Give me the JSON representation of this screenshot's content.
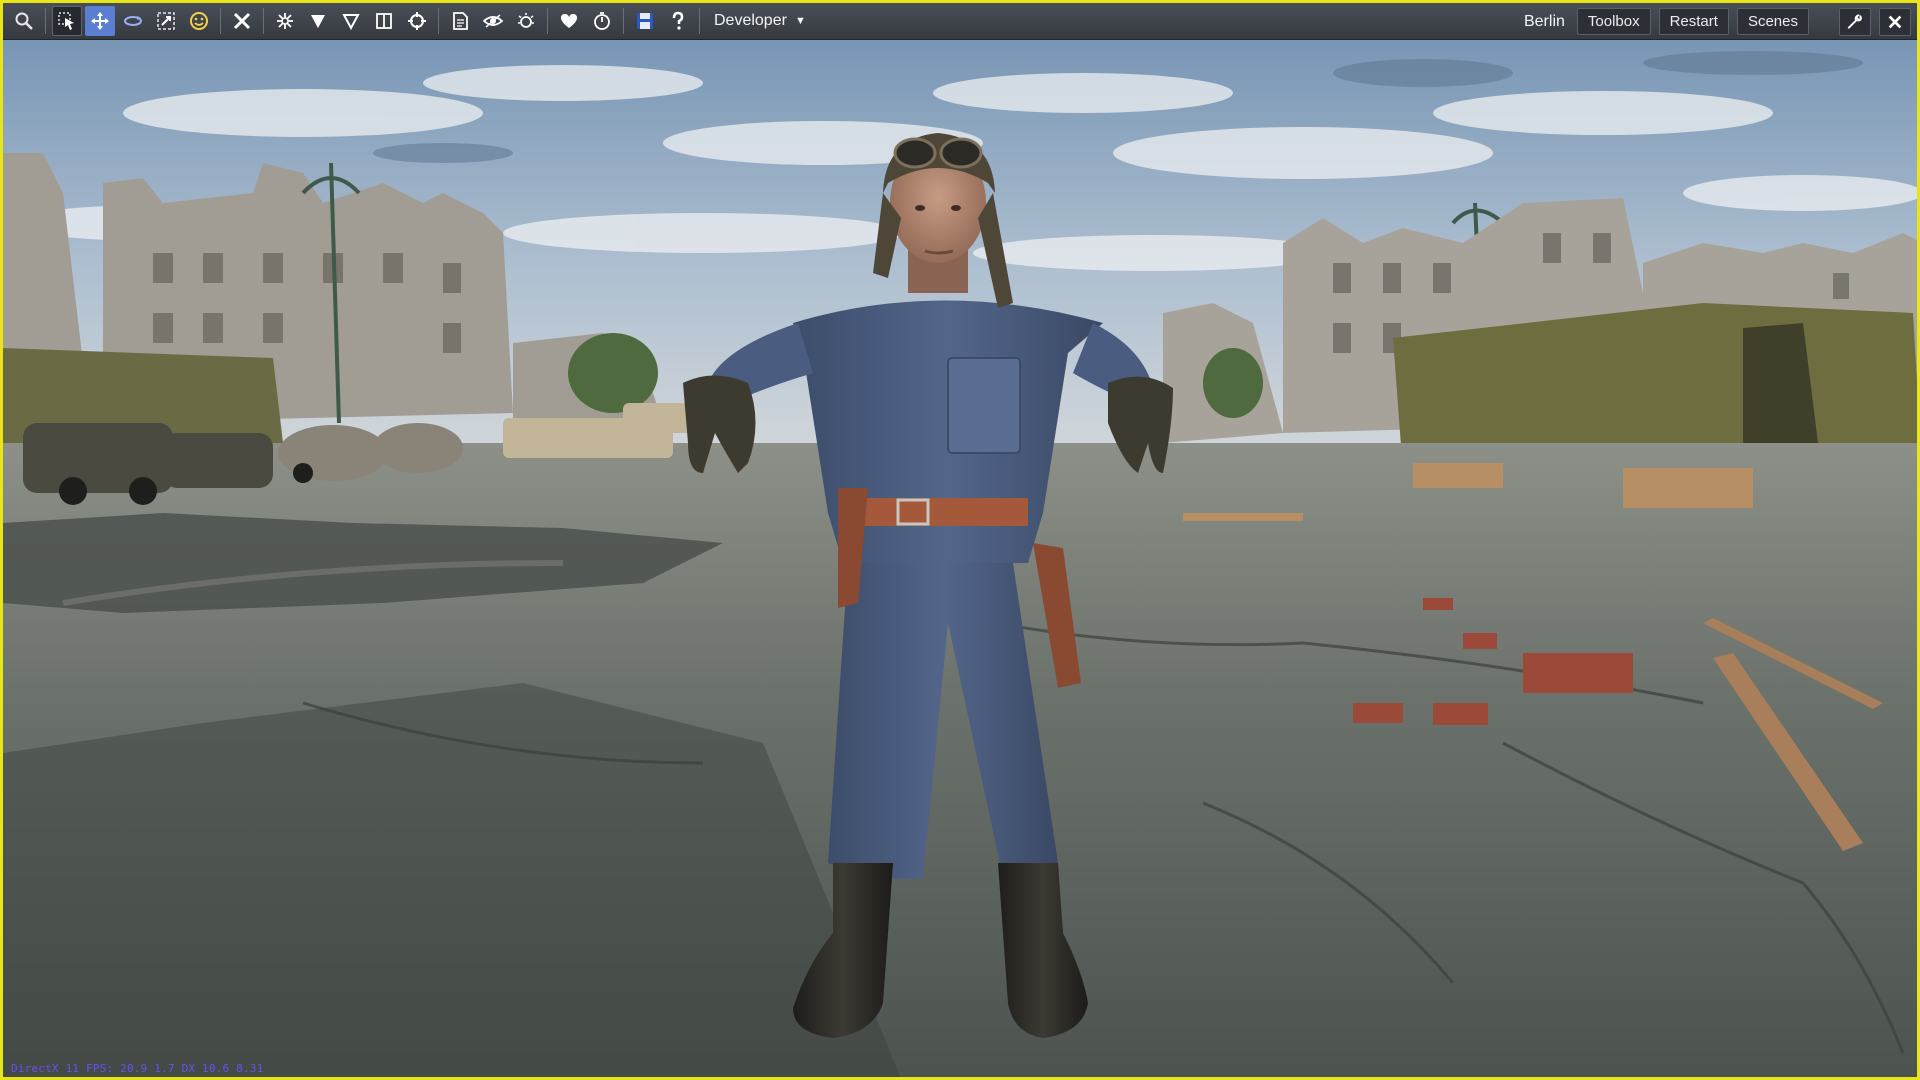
{
  "toolbar": {
    "mode_dropdown": {
      "selected": "Developer"
    },
    "tools": [
      {
        "icon": "search-icon"
      },
      {
        "icon": "select-cursor-icon"
      },
      {
        "icon": "move-arrows-icon"
      },
      {
        "icon": "rotate-icon"
      },
      {
        "icon": "scale-icon"
      },
      {
        "icon": "smiley-icon"
      },
      {
        "icon": "cross-tools-icon"
      },
      {
        "icon": "snap-icon"
      },
      {
        "icon": "filled-triangle-icon"
      },
      {
        "icon": "outline-triangle-icon"
      },
      {
        "icon": "split-panel-icon"
      },
      {
        "icon": "crosshair-icon"
      },
      {
        "icon": "document-icon"
      },
      {
        "icon": "eye-icon"
      },
      {
        "icon": "sun-icon"
      },
      {
        "icon": "heart-icon"
      },
      {
        "icon": "stopwatch-icon"
      },
      {
        "icon": "save-icon"
      },
      {
        "icon": "help-icon"
      }
    ],
    "right": {
      "location": "Berlin",
      "toolbox_label": "Toolbox",
      "restart_label": "Restart",
      "scenes_label": "Scenes",
      "wrench_icon": "wrench-icon",
      "close_icon": "close-icon"
    }
  },
  "stats": {
    "text": "DirectX 11  FPS: 20.9  1.7  DX 10.6  8.31"
  },
  "colors": {
    "frame_border": "#e8e619",
    "toolbar_bg": "#3e434a",
    "active_tool": "#5b7fd0",
    "stats_text": "#6b4df0"
  }
}
